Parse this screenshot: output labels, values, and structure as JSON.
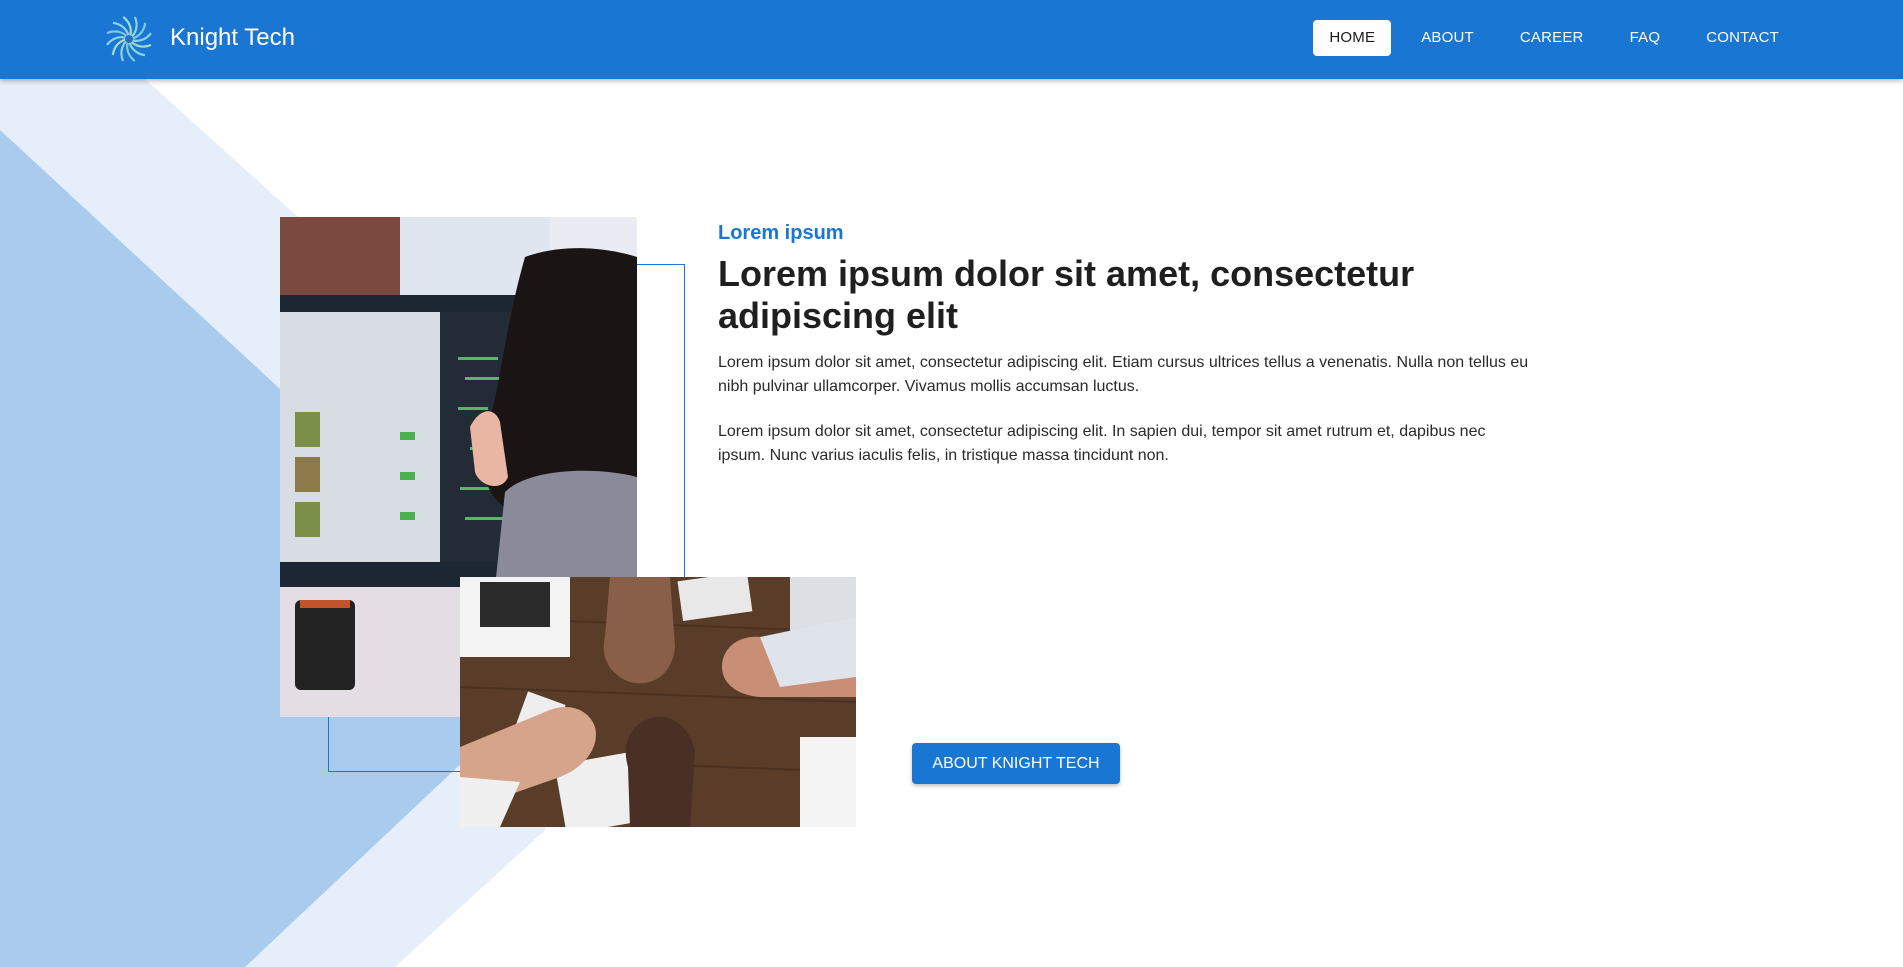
{
  "header": {
    "brand": "Knight Tech",
    "logo_icon": "spiral-logo-icon",
    "background_color": "#1976d2"
  },
  "nav": {
    "items": [
      {
        "label": "HOME",
        "active": true
      },
      {
        "label": "ABOUT",
        "active": false
      },
      {
        "label": "CAREER",
        "active": false
      },
      {
        "label": "FAQ",
        "active": false
      },
      {
        "label": "CONTACT",
        "active": false
      }
    ]
  },
  "hero": {
    "eyebrow": "Lorem ipsum",
    "headline": "Lorem ipsum dolor sit amet, consectetur adipiscing elit",
    "paragraphs": [
      "Lorem ipsum dolor sit amet, consectetur adipiscing elit. Etiam cursus ultrices tellus a venenatis. Nulla non tellus eu nibh pulvinar ullamcorper. Vivamus mollis accumsan luctus.",
      "Lorem ipsum dolor sit amet, consectetur adipiscing elit. In sapien dui, tempor sit amet rutrum et, dapibus nec ipsum. Nunc varius iaculis felis, in tristique massa tincidunt non."
    ],
    "cta_label": "ABOUT KNIGHT TECH",
    "images": [
      {
        "name": "woman-at-computer-photo"
      },
      {
        "name": "team-fist-bump-photo"
      }
    ]
  },
  "colors": {
    "accent": "#1976d2",
    "bg_shape_light": "#e6eff9",
    "bg_shape_mid": "#a8cbee"
  }
}
